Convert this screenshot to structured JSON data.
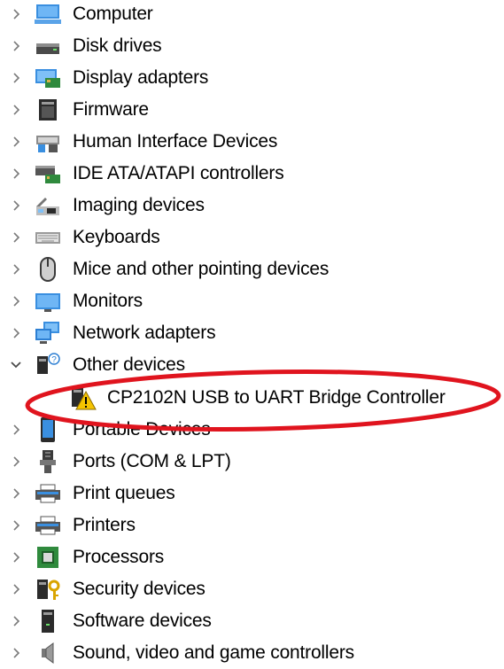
{
  "tree": {
    "items": [
      {
        "label": "Computer",
        "icon": "computer-icon",
        "expanded": false
      },
      {
        "label": "Disk drives",
        "icon": "disk-drive-icon",
        "expanded": false
      },
      {
        "label": "Display adapters",
        "icon": "display-adapter-icon",
        "expanded": false
      },
      {
        "label": "Firmware",
        "icon": "firmware-icon",
        "expanded": false
      },
      {
        "label": "Human Interface Devices",
        "icon": "hid-icon",
        "expanded": false
      },
      {
        "label": "IDE ATA/ATAPI controllers",
        "icon": "ide-controller-icon",
        "expanded": false
      },
      {
        "label": "Imaging devices",
        "icon": "imaging-device-icon",
        "expanded": false
      },
      {
        "label": "Keyboards",
        "icon": "keyboard-icon",
        "expanded": false
      },
      {
        "label": "Mice and other pointing devices",
        "icon": "mouse-icon",
        "expanded": false
      },
      {
        "label": "Monitors",
        "icon": "monitor-icon",
        "expanded": false
      },
      {
        "label": "Network adapters",
        "icon": "network-adapter-icon",
        "expanded": false
      },
      {
        "label": "Other devices",
        "icon": "other-devices-icon",
        "expanded": true
      },
      {
        "label": "CP2102N USB to UART Bridge Controller",
        "icon": "warning-device-icon",
        "child": true
      },
      {
        "label": "Portable Devices",
        "icon": "portable-device-icon",
        "expanded": false
      },
      {
        "label": "Ports (COM & LPT)",
        "icon": "port-icon",
        "expanded": false
      },
      {
        "label": "Print queues",
        "icon": "print-queue-icon",
        "expanded": false
      },
      {
        "label": "Printers",
        "icon": "printer-icon",
        "expanded": false
      },
      {
        "label": "Processors",
        "icon": "processor-icon",
        "expanded": false
      },
      {
        "label": "Security devices",
        "icon": "security-device-icon",
        "expanded": false
      },
      {
        "label": "Software devices",
        "icon": "software-device-icon",
        "expanded": false
      },
      {
        "label": "Sound, video and game controllers",
        "icon": "sound-controller-icon",
        "expanded": false
      }
    ]
  },
  "highlight": {
    "color": "#e0141e",
    "target": "CP2102N USB to UART Bridge Controller"
  },
  "colors": {
    "chevron": "#7a7a7a",
    "accent": "#2d7fd3",
    "warning": "#f5c400"
  }
}
